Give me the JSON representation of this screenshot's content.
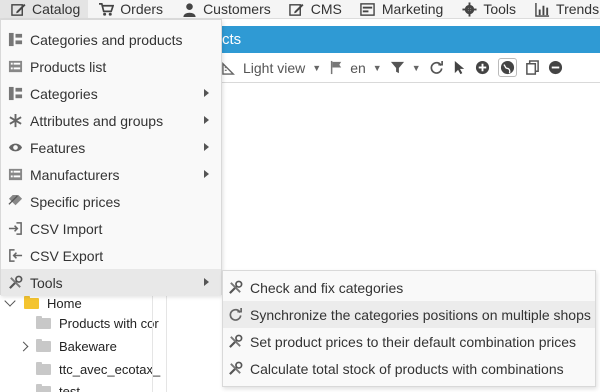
{
  "topnav": {
    "items": [
      {
        "label": "Catalog",
        "icon": "edit-icon"
      },
      {
        "label": "Orders",
        "icon": "cart-icon"
      },
      {
        "label": "Customers",
        "icon": "user-icon"
      },
      {
        "label": "CMS",
        "icon": "edit-icon"
      },
      {
        "label": "Marketing",
        "icon": "campaign-icon"
      },
      {
        "label": "Tools",
        "icon": "gear-icon"
      },
      {
        "label": "Trends",
        "icon": "bar-chart-icon"
      }
    ]
  },
  "header": {
    "title_fragment": "cts"
  },
  "toolbar": {
    "view_label": "Light view",
    "lang_label": "en"
  },
  "catalog_menu": {
    "items": [
      {
        "label": "Categories and products",
        "icon": "category-tree-icon",
        "submenu": false
      },
      {
        "label": "Products list",
        "icon": "list-icon",
        "submenu": false
      },
      {
        "label": "Categories",
        "icon": "category-tree-icon",
        "submenu": true
      },
      {
        "label": "Attributes and groups",
        "icon": "asterisk-icon",
        "submenu": true
      },
      {
        "label": "Features",
        "icon": "eye-icon",
        "submenu": true
      },
      {
        "label": "Manufacturers",
        "icon": "list-icon",
        "submenu": true
      },
      {
        "label": "Specific prices",
        "icon": "price-tag-icon",
        "submenu": false
      },
      {
        "label": "CSV Import",
        "icon": "import-icon",
        "submenu": false
      },
      {
        "label": "CSV Export",
        "icon": "export-icon",
        "submenu": false
      },
      {
        "label": "Tools",
        "icon": "tools-icon",
        "submenu": true
      }
    ]
  },
  "tools_submenu": {
    "items": [
      {
        "label": "Check and fix categories",
        "icon": "tools-icon"
      },
      {
        "label": "Synchronize the categories positions on multiple shops",
        "icon": "refresh-icon"
      },
      {
        "label": "Set product prices to their default combination prices",
        "icon": "tools-icon"
      },
      {
        "label": "Calculate total stock of products with combinations",
        "icon": "tools-icon"
      }
    ]
  },
  "tree": {
    "items": [
      {
        "label": "Home"
      },
      {
        "label": "Products with cor"
      },
      {
        "label": "Bakeware"
      },
      {
        "label": "ttc_avec_ecotax_"
      },
      {
        "label": "test"
      }
    ]
  },
  "colors": {
    "header_blue": "#2f9ad4",
    "menu_bg": "#f9f9f9",
    "folder_yellow": "#f4c430"
  }
}
